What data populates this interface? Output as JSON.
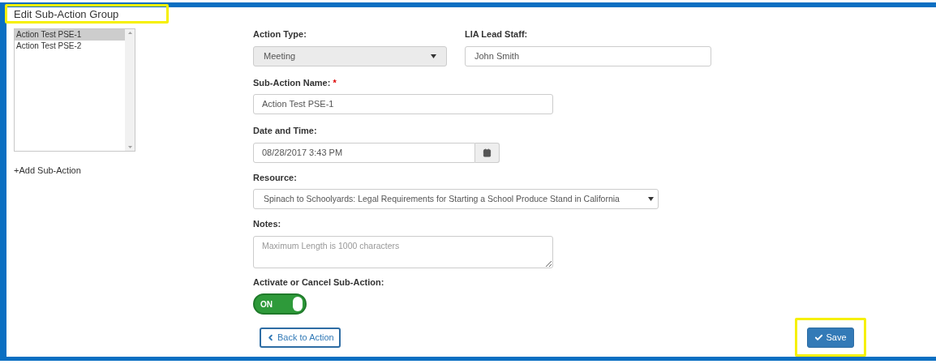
{
  "title": "Edit Sub-Action Group",
  "sub_actions": [
    {
      "label": "Action Test PSE-1",
      "selected": true
    },
    {
      "label": "Action Test PSE-2",
      "selected": false
    }
  ],
  "add_link": "+Add Sub-Action",
  "action_type": {
    "label": "Action Type:",
    "value": "Meeting",
    "disabled": true
  },
  "lead_staff": {
    "label": "LIA Lead Staff:",
    "value": "John Smith"
  },
  "sub_action_name": {
    "label": "Sub-Action Name:",
    "required_mark": "*",
    "value": "Action Test PSE-1"
  },
  "date_time": {
    "label": "Date and Time:",
    "value": "08/28/2017 3:43 PM"
  },
  "resource": {
    "label": "Resource:",
    "value": "Spinach to Schoolyards: Legal Requirements for Starting a School Produce Stand in California"
  },
  "notes": {
    "label": "Notes:",
    "placeholder": "Maximum Length is 1000 characters"
  },
  "activate": {
    "label": "Activate or Cancel Sub-Action:",
    "on": true,
    "on_text": "ON"
  },
  "back_button": "Back to Action",
  "save_button": "Save"
}
